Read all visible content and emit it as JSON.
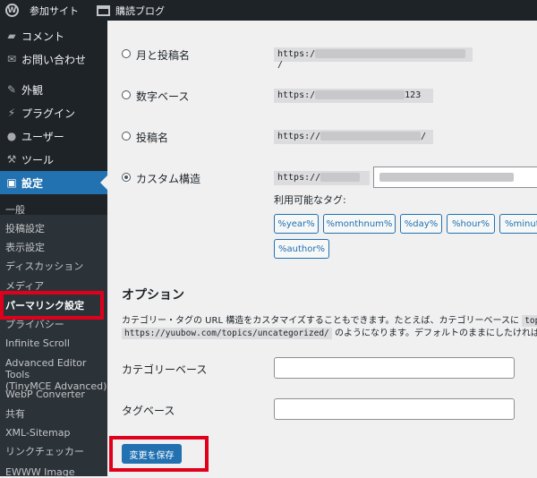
{
  "adminbar": {
    "site_name": "参加サイト",
    "dashboard_item": "購読ブログ"
  },
  "sidebar": {
    "menu": [
      {
        "label": "コメント",
        "icon": "comment-icon"
      },
      {
        "label": "お問い合わせ",
        "icon": "mail-icon"
      },
      {
        "label": "外観",
        "icon": "brush-icon"
      },
      {
        "label": "プラグイン",
        "icon": "plugin-icon"
      },
      {
        "label": "ユーザー",
        "icon": "user-icon"
      },
      {
        "label": "ツール",
        "icon": "wrench-icon"
      },
      {
        "label": "設定",
        "icon": "settings-icon"
      }
    ],
    "submenu": [
      "一般",
      "投稿設定",
      "表示設定",
      "ディスカッション",
      "メディア",
      "パーマリンク設定",
      "プライバシー",
      "Infinite Scroll",
      "Advanced Editor Tools",
      "(TinyMCE Advanced)",
      "WebP Converter",
      "共有",
      "XML-Sitemap",
      "リンクチェッカー",
      "EWWW Image"
    ]
  },
  "permalink": {
    "options": [
      {
        "label": "月と投稿名",
        "prefix": "https:/",
        "suffix": "/"
      },
      {
        "label": "数字ベース",
        "prefix": "https:/",
        "suffix": "123"
      },
      {
        "label": "投稿名",
        "prefix": "https://",
        "suffix": "/"
      },
      {
        "label": "カスタム構造",
        "prefix": "https://"
      }
    ],
    "tags_label": "利用可能なタグ:",
    "tags": [
      "%year%",
      "%monthnum%",
      "%day%",
      "%hour%",
      "%minut",
      "%author%"
    ]
  },
  "options_section": {
    "title": "オプション",
    "desc_line1_a": "カテゴリー・タグの URL 構造をカスタマイズすることもできます。たとえば、カテゴリーベースに",
    "desc_line1_code": "top",
    "desc_line2_code": "https://yuubow.com/topics/uncategorized/",
    "desc_line2_b": "のようになります。デフォルトのままにしたければ空",
    "category_base_label": "カテゴリーベース",
    "tag_base_label": "タグベース",
    "save_label": "変更を保存"
  },
  "colors": {
    "accent": "#2271b1",
    "highlight_box": "#e0001b",
    "sidebar_bg": "#1d2327"
  }
}
